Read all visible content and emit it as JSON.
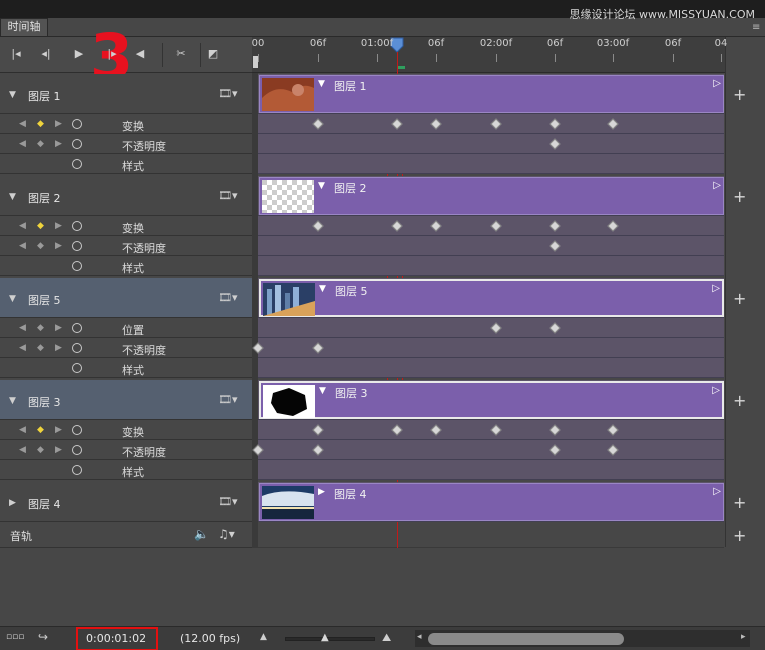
{
  "panel": {
    "tab_label": "时间轴",
    "watermark": "思缘设计论坛 www.MISSYUAN.COM",
    "menu_icon": "panel-menu-icon"
  },
  "controls": {
    "items": [
      {
        "name": "go-to-first-frame-button",
        "glyph": "|◂"
      },
      {
        "name": "previous-frame-button",
        "glyph": "◂|"
      },
      {
        "name": "play-button",
        "glyph": "▶"
      },
      {
        "name": "next-frame-button",
        "glyph": "|▸"
      },
      {
        "name": "audio-button",
        "glyph": "◀"
      },
      {
        "name": "split-scissors-button",
        "glyph": "✂"
      },
      {
        "name": "transition-button",
        "glyph": "◩"
      }
    ],
    "annotation_number": "3"
  },
  "ruler": {
    "labels": [
      "00",
      "06f",
      "01:00f",
      "06f",
      "02:00f",
      "06f",
      "03:00f",
      "06f",
      "04"
    ]
  },
  "layers": [
    {
      "name": "图层 1",
      "expanded": true,
      "selected": false,
      "clip_label": "图层 1",
      "thumbnail": "hands-photo",
      "properties": [
        {
          "name": "变换",
          "keyframes": [
            1,
            2,
            3,
            4,
            5,
            6
          ],
          "stopwatch_on": true
        },
        {
          "name": "不透明度",
          "keyframes": [
            5
          ],
          "stopwatch_on": true
        },
        {
          "name": "样式",
          "keyframes": [],
          "stopwatch_on": false
        }
      ]
    },
    {
      "name": "图层 2",
      "expanded": true,
      "selected": false,
      "clip_label": "图层 2",
      "thumbnail": "transparent",
      "properties": [
        {
          "name": "变换",
          "keyframes": [
            1,
            2,
            3,
            4,
            5,
            6
          ],
          "stopwatch_on": true
        },
        {
          "name": "不透明度",
          "keyframes": [
            5
          ],
          "stopwatch_on": true
        },
        {
          "name": "样式",
          "keyframes": [],
          "stopwatch_on": false
        }
      ]
    },
    {
      "name": "图层 5",
      "expanded": true,
      "selected": true,
      "clip_label": "图层 5",
      "thumbnail": "city-photo",
      "properties": [
        {
          "name": "位置",
          "keyframes": [
            4,
            5
          ],
          "stopwatch_on": true
        },
        {
          "name": "不透明度",
          "keyframes": [
            0,
            1
          ],
          "stopwatch_on": true
        },
        {
          "name": "样式",
          "keyframes": [],
          "stopwatch_on": false
        }
      ]
    },
    {
      "name": "图层 3",
      "expanded": true,
      "selected": true,
      "clip_label": "图层 3",
      "thumbnail": "black-shape",
      "properties": [
        {
          "name": "变换",
          "keyframes": [
            1,
            2,
            3,
            4,
            5,
            6
          ],
          "stopwatch_on": true
        },
        {
          "name": "不透明度",
          "keyframes": [
            0,
            1,
            5,
            6
          ],
          "stopwatch_on": true
        },
        {
          "name": "样式",
          "keyframes": [],
          "stopwatch_on": false
        }
      ]
    },
    {
      "name": "图层 4",
      "expanded": false,
      "selected": false,
      "clip_label": "图层 4",
      "thumbnail": "sky-photo",
      "properties": []
    }
  ],
  "audio": {
    "label": "音轨"
  },
  "status": {
    "current_time": "0:00:01:02",
    "fps": "(12.00 fps)"
  },
  "colors": {
    "clip": "#7b5fab",
    "playhead": "#c21a1a",
    "annotation": "#e31010",
    "active_keyframe_nav": "#f0d43c"
  }
}
